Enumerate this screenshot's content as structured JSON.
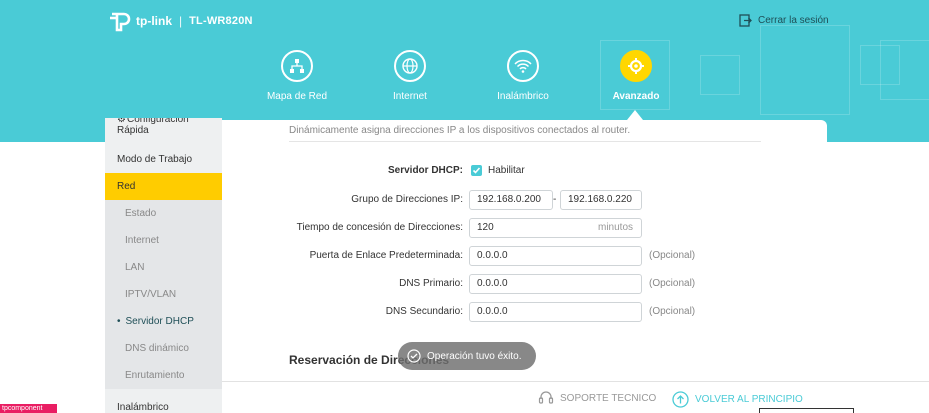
{
  "header": {
    "brand": "tp-link",
    "separator": "|",
    "model": "TL-WR820N",
    "logout_label": "Cerrar la sesión",
    "accent_color": "#4acbd6",
    "active_color": "#ffd700"
  },
  "nav": [
    {
      "label": "Mapa de Red",
      "icon": "network-map-icon"
    },
    {
      "label": "Internet",
      "icon": "globe-icon"
    },
    {
      "label": "Inalámbrico",
      "icon": "wifi-icon"
    },
    {
      "label": "Avanzado",
      "icon": "gear-icon",
      "active": true
    }
  ],
  "sidebar": {
    "top_item": "Configuración Rápida",
    "items": [
      "Modo de Trabajo",
      "Red"
    ],
    "sub_items": [
      "Estado",
      "Internet",
      "LAN",
      "IPTV/VLAN",
      "Servidor DHCP",
      "DNS dinámico",
      "Enrutamiento"
    ],
    "bottom_item": "Inalámbrico"
  },
  "main": {
    "description": "Dinámicamente asigna direcciones IP a los dispositivos conectados al router.",
    "dhcp_server_label": "Servidor DHCP:",
    "enable_label": "Habilitar",
    "pool_label": "Grupo de Direcciones IP:",
    "pool_start": "192.168.0.200",
    "pool_sep": "-",
    "pool_end": "192.168.0.220",
    "lease_label": "Tiempo de concesión de Direcciones:",
    "lease_value": "120",
    "lease_unit": "minutos",
    "gateway_label": "Puerta de Enlace Predeterminada:",
    "gateway_value": "0.0.0.0",
    "dns1_label": "DNS Primario:",
    "dns1_value": "0.0.0.0",
    "dns2_label": "DNS Secundario:",
    "dns2_value": "0.0.0.0",
    "optional": "(Opcional)",
    "reservation_title": "Reservación de Direcciones"
  },
  "toast": {
    "message": "Operación tuvo éxito."
  },
  "footer": {
    "support": "SOPORTE TECNICO",
    "back": "VOLVER AL PRINCIPIO"
  },
  "debug_badge": "tpcomponent"
}
